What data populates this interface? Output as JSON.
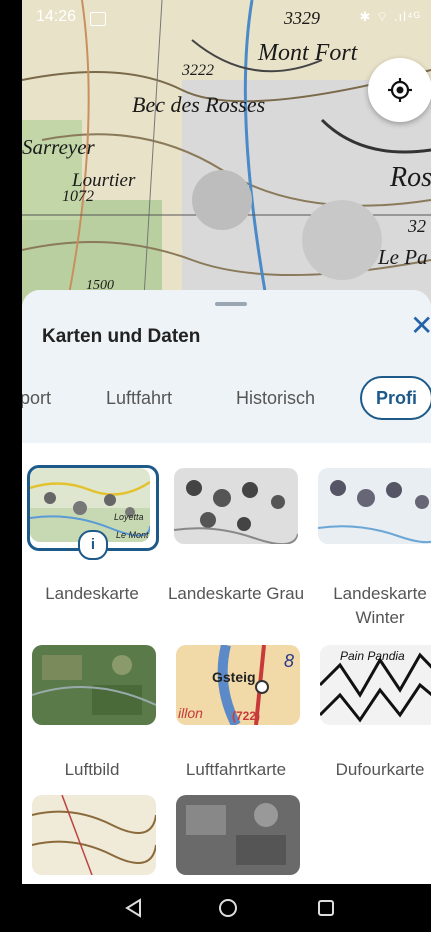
{
  "status_bar": {
    "time": "14:26",
    "right_icons": "✱ ⌔ .ıl⁴ᴳ"
  },
  "map": {
    "labels": [
      "Mont Fort",
      "3222",
      "Bec des Rosses",
      "Sarreyer",
      "Lourtier",
      "1072",
      "Ros",
      "Le Pa",
      "3329",
      "32",
      "1500"
    ]
  },
  "sheet": {
    "title": "Karten und Daten",
    "close_symbol": "✕",
    "tabs": [
      "port",
      "Luftfahrt",
      "Historisch",
      "Profi"
    ],
    "active_tab": "Profi"
  },
  "layers": [
    {
      "name": "Landeskarte",
      "selected": true
    },
    {
      "name": "Landeskarte Grau",
      "selected": false
    },
    {
      "name": "Landeskarte Winter",
      "selected": false
    },
    {
      "name": "Luftbild",
      "selected": false
    },
    {
      "name": "Luftfahrtkarte",
      "selected": false
    },
    {
      "name": "Dufourkarte",
      "selected": false
    },
    {
      "name": "",
      "selected": false
    },
    {
      "name": "",
      "selected": false
    }
  ],
  "info_badge": "i",
  "thumb_texts": {
    "landeskarte_a": "Loyetta",
    "landeskarte_b": "Le Mont",
    "luftfahrt_a": "Gsteig",
    "luftfahrt_b": "(722)",
    "luftfahrt_c": "8",
    "luftfahrt_d": "illon",
    "dufour_a": "Pain Pandia"
  },
  "nav": {
    "back": "back-icon",
    "home": "home-icon",
    "recents": "recents-icon"
  }
}
